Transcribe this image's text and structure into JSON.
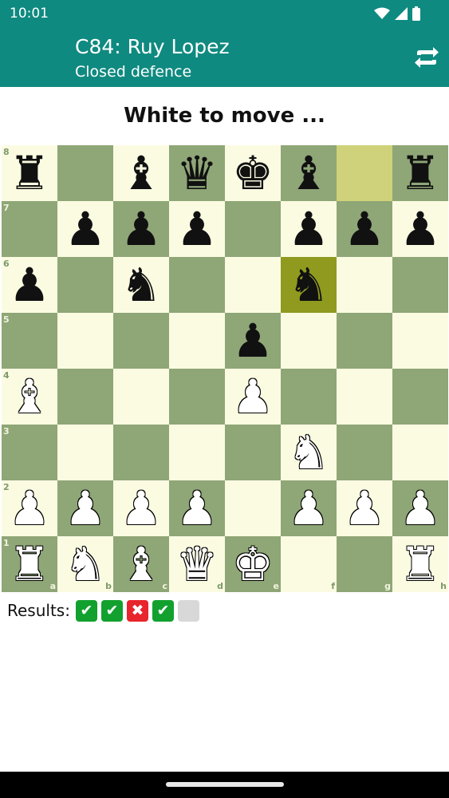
{
  "status": {
    "time": "10:01"
  },
  "app": {
    "title": "C84: Ruy Lopez",
    "subtitle": "Closed defence"
  },
  "colors": {
    "appbar": "#0f8a80",
    "light_square": "#fbfbe2",
    "dark_square": "#8fa677",
    "highlight": "#8f9a1f",
    "ok": "#12a12e",
    "bad": "#e8242c"
  },
  "prompt": "White to move ...",
  "board": {
    "files": [
      "a",
      "b",
      "c",
      "d",
      "e",
      "f",
      "g",
      "h"
    ],
    "ranks": [
      "8",
      "7",
      "6",
      "5",
      "4",
      "3",
      "2",
      "1"
    ],
    "highlighted": [
      "g8",
      "f6"
    ],
    "pieces": [
      {
        "sq": "a8",
        "glyph": "♜",
        "color": "black",
        "name": "black-rook"
      },
      {
        "sq": "c8",
        "glyph": "♝",
        "color": "black",
        "name": "black-bishop"
      },
      {
        "sq": "d8",
        "glyph": "♛",
        "color": "black",
        "name": "black-queen"
      },
      {
        "sq": "e8",
        "glyph": "♚",
        "color": "black",
        "name": "black-king"
      },
      {
        "sq": "f8",
        "glyph": "♝",
        "color": "black",
        "name": "black-bishop"
      },
      {
        "sq": "h8",
        "glyph": "♜",
        "color": "black",
        "name": "black-rook"
      },
      {
        "sq": "b7",
        "glyph": "♟",
        "color": "black",
        "name": "black-pawn"
      },
      {
        "sq": "c7",
        "glyph": "♟",
        "color": "black",
        "name": "black-pawn"
      },
      {
        "sq": "d7",
        "glyph": "♟",
        "color": "black",
        "name": "black-pawn"
      },
      {
        "sq": "f7",
        "glyph": "♟",
        "color": "black",
        "name": "black-pawn"
      },
      {
        "sq": "g7",
        "glyph": "♟",
        "color": "black",
        "name": "black-pawn"
      },
      {
        "sq": "h7",
        "glyph": "♟",
        "color": "black",
        "name": "black-pawn"
      },
      {
        "sq": "a6",
        "glyph": "♟",
        "color": "black",
        "name": "black-pawn"
      },
      {
        "sq": "c6",
        "glyph": "♞",
        "color": "black",
        "name": "black-knight"
      },
      {
        "sq": "f6",
        "glyph": "♞",
        "color": "black",
        "name": "black-knight"
      },
      {
        "sq": "e5",
        "glyph": "♟",
        "color": "black",
        "name": "black-pawn"
      },
      {
        "sq": "a4",
        "glyph": "♝",
        "color": "white",
        "name": "white-bishop"
      },
      {
        "sq": "e4",
        "glyph": "♟",
        "color": "white",
        "name": "white-pawn"
      },
      {
        "sq": "f3",
        "glyph": "♞",
        "color": "white",
        "name": "white-knight"
      },
      {
        "sq": "a2",
        "glyph": "♟",
        "color": "white",
        "name": "white-pawn"
      },
      {
        "sq": "b2",
        "glyph": "♟",
        "color": "white",
        "name": "white-pawn"
      },
      {
        "sq": "c2",
        "glyph": "♟",
        "color": "white",
        "name": "white-pawn"
      },
      {
        "sq": "d2",
        "glyph": "♟",
        "color": "white",
        "name": "white-pawn"
      },
      {
        "sq": "f2",
        "glyph": "♟",
        "color": "white",
        "name": "white-pawn"
      },
      {
        "sq": "g2",
        "glyph": "♟",
        "color": "white",
        "name": "white-pawn"
      },
      {
        "sq": "h2",
        "glyph": "♟",
        "color": "white",
        "name": "white-pawn"
      },
      {
        "sq": "a1",
        "glyph": "♜",
        "color": "white",
        "name": "white-rook"
      },
      {
        "sq": "b1",
        "glyph": "♞",
        "color": "white",
        "name": "white-knight"
      },
      {
        "sq": "c1",
        "glyph": "♝",
        "color": "white",
        "name": "white-bishop"
      },
      {
        "sq": "d1",
        "glyph": "♛",
        "color": "white",
        "name": "white-queen"
      },
      {
        "sq": "e1",
        "glyph": "♚",
        "color": "white",
        "name": "white-king"
      },
      {
        "sq": "h1",
        "glyph": "♜",
        "color": "white",
        "name": "white-rook"
      }
    ]
  },
  "results": {
    "label": "Results:",
    "items": [
      {
        "state": "ok",
        "glyph": "✔"
      },
      {
        "state": "ok",
        "glyph": "✔"
      },
      {
        "state": "bad",
        "glyph": "✖"
      },
      {
        "state": "ok",
        "glyph": "✔"
      },
      {
        "state": "pending",
        "glyph": ""
      }
    ]
  }
}
